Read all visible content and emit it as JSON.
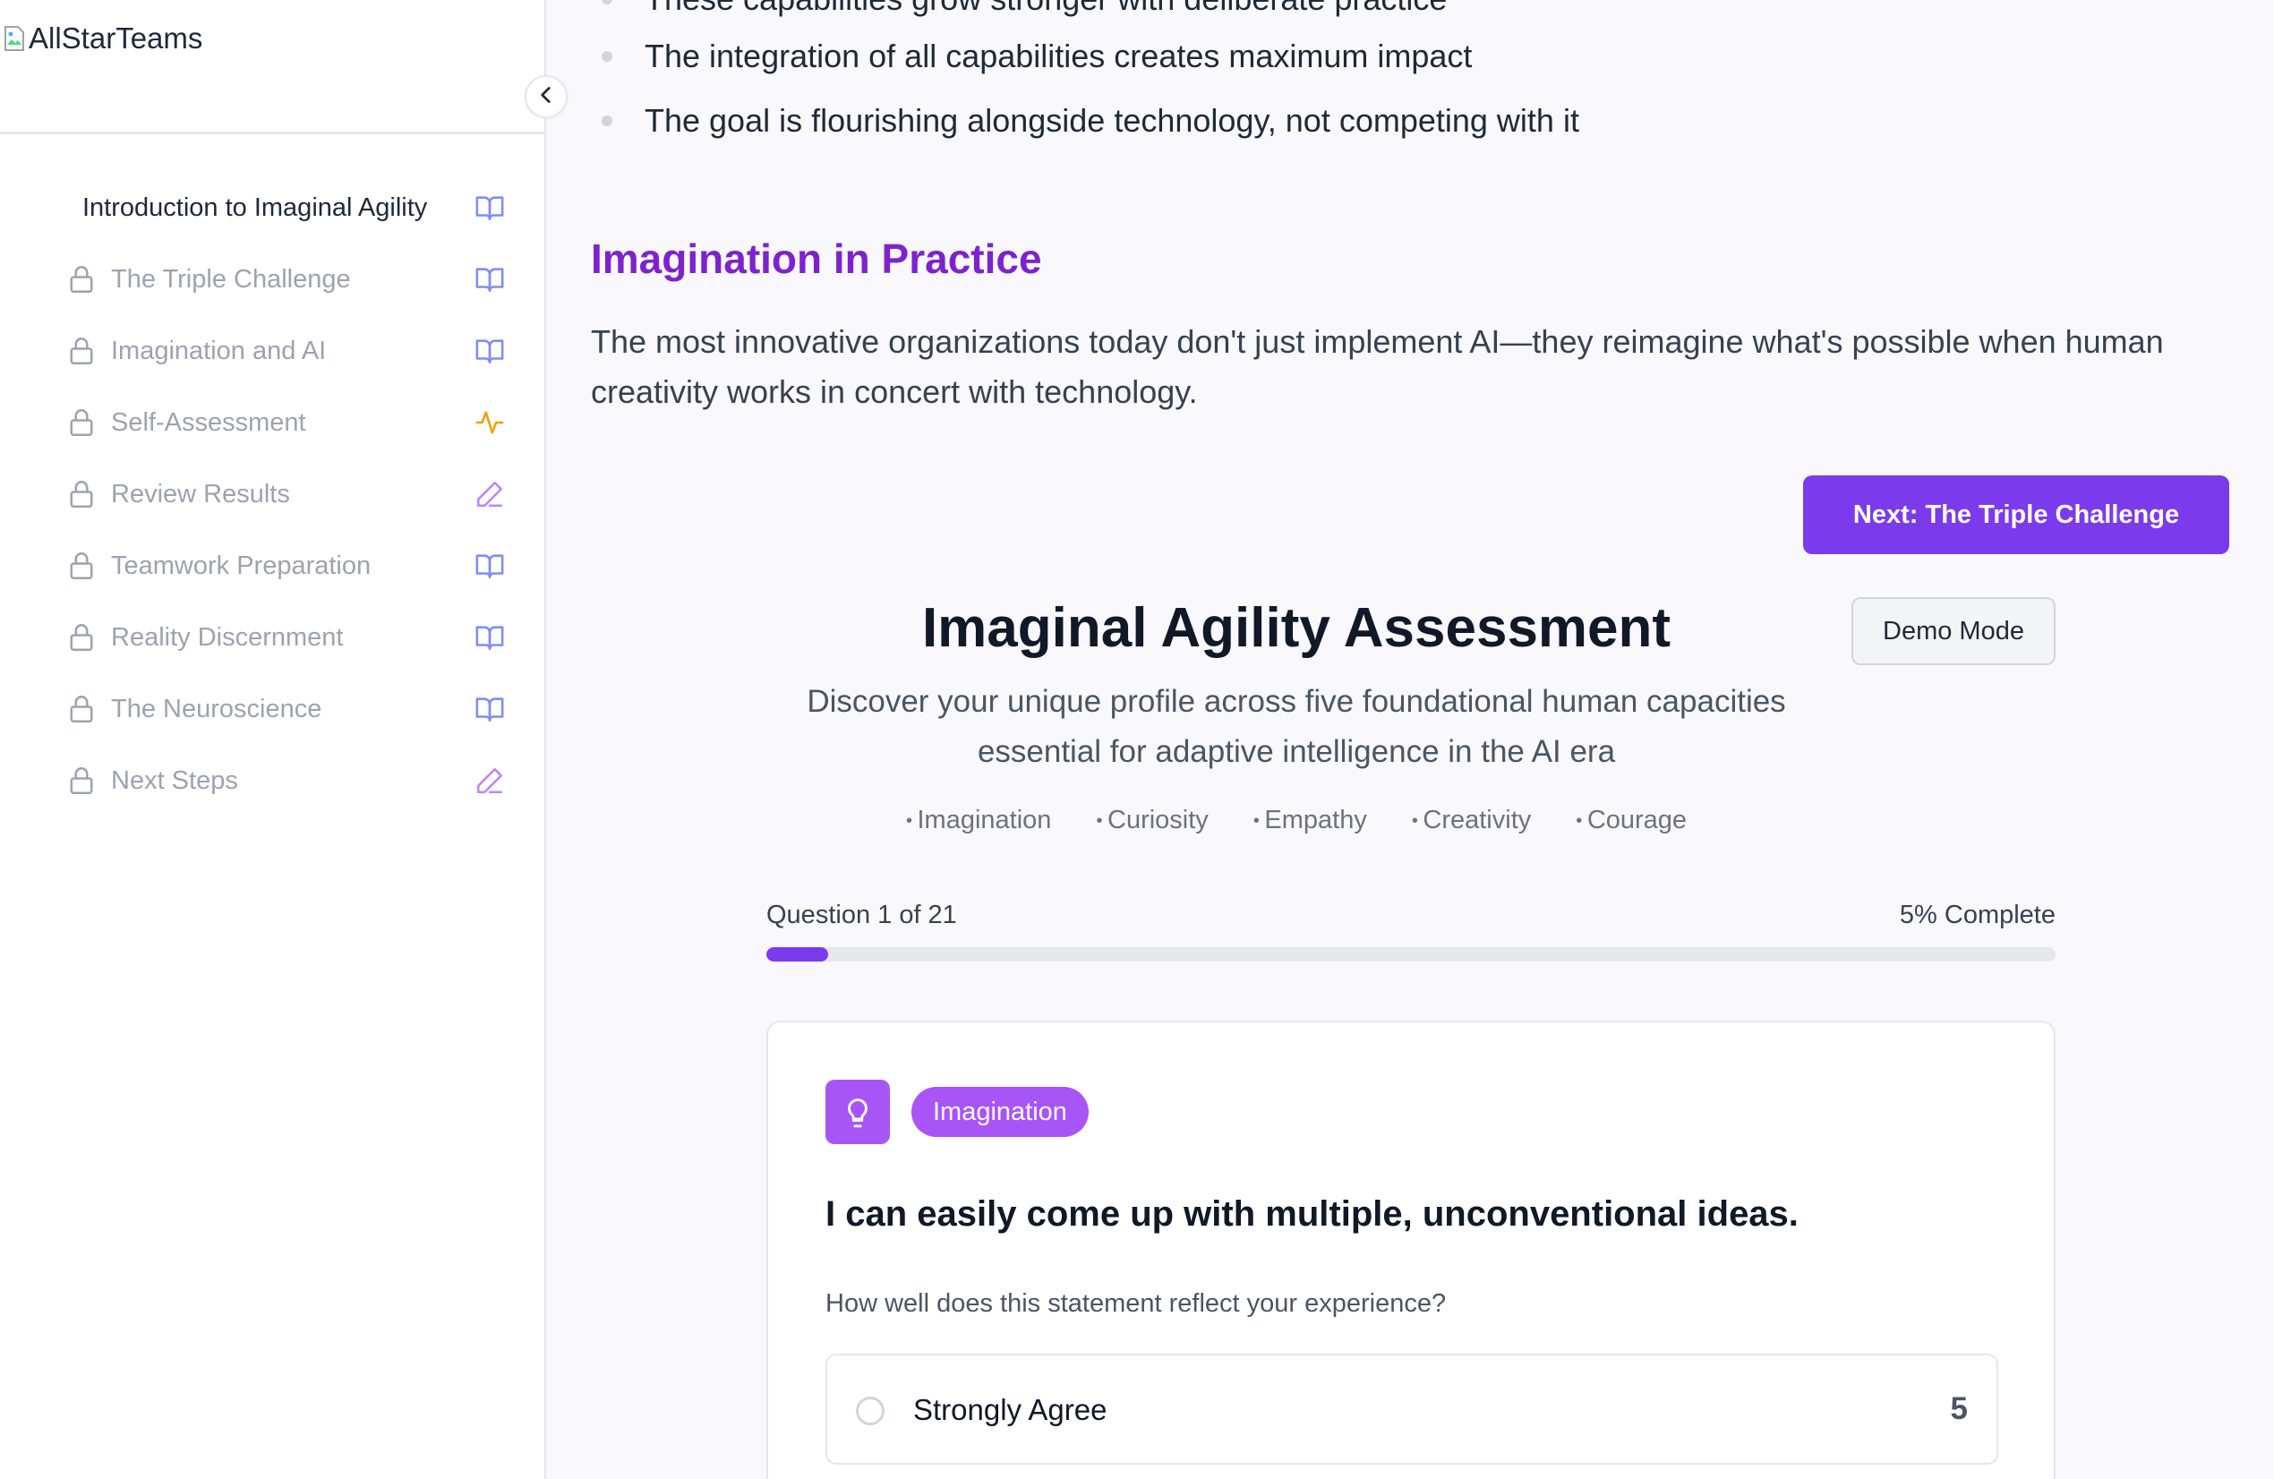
{
  "sidebar": {
    "logo_alt": "AllStarTeams",
    "items": [
      {
        "label": "Introduction to Imaginal Agility",
        "locked": false,
        "icon": "book-icon"
      },
      {
        "label": "The Triple Challenge",
        "locked": true,
        "icon": "book-icon"
      },
      {
        "label": "Imagination and AI",
        "locked": true,
        "icon": "book-icon"
      },
      {
        "label": "Self-Assessment",
        "locked": true,
        "icon": "activity-icon"
      },
      {
        "label": "Review Results",
        "locked": true,
        "icon": "pencil-icon"
      },
      {
        "label": "Teamwork Preparation",
        "locked": true,
        "icon": "book-icon"
      },
      {
        "label": "Reality Discernment",
        "locked": true,
        "icon": "book-icon"
      },
      {
        "label": "The Neuroscience",
        "locked": true,
        "icon": "book-icon"
      },
      {
        "label": "Next Steps",
        "locked": true,
        "icon": "pencil-icon"
      }
    ]
  },
  "content": {
    "bullets": [
      "These capabilities grow stronger with deliberate practice",
      "The integration of all capabilities creates maximum impact",
      "The goal is flourishing alongside technology, not competing with it"
    ],
    "section_title": "Imagination in Practice",
    "section_text": "The most innovative organizations today don't just implement AI—they reimagine what's possible when human creativity works in concert with technology.",
    "next_button": "Next: The Triple Challenge"
  },
  "assessment": {
    "title": "Imaginal Agility Assessment",
    "demo_button": "Demo Mode",
    "subtitle_line1": "Discover your unique profile across five foundational human capacities",
    "subtitle_line2": "essential for adaptive intelligence in the AI era",
    "capacities": [
      "Imagination",
      "Curiosity",
      "Empathy",
      "Creativity",
      "Courage"
    ],
    "progress_label": "Question 1 of 21",
    "progress_pct_label": "5% Complete",
    "progress_fraction": 0.048,
    "question": {
      "category": "Imagination",
      "icon": "lightbulb-icon",
      "text": "I can easily come up with multiple, unconventional ideas.",
      "help": "How well does this statement reflect your experience?",
      "options": [
        {
          "label": "Strongly Agree",
          "value": "5"
        }
      ]
    }
  },
  "colors": {
    "accent": "#7c3aed",
    "section_title": "#7e22ce",
    "badge": "#a855f7",
    "book_icon": "#818cf8",
    "activity_icon": "#f59e0b",
    "pencil_icon": "#c084fc"
  }
}
